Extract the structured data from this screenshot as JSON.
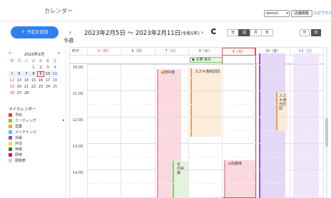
{
  "header": {
    "app_title": "カレンダー",
    "user_select": "demo1",
    "store_button": "店舗移動",
    "logout": "ログアウト"
  },
  "toolbar": {
    "add_button": "＋ 予定を追加",
    "prev": "‹",
    "next": "›",
    "range_title": "2023年2月5日 ～ 2023年2月11日",
    "range_week": "(令和5年)",
    "today_label": "今週",
    "views": [
      "日",
      "週",
      "月",
      "年"
    ],
    "active_view": "週",
    "print": "印",
    "export": "出"
  },
  "mini_calendar": {
    "title": "2023年2月",
    "prev": "«",
    "next": "»",
    "weekdays": [
      "日",
      "月",
      "火",
      "水",
      "木",
      "金",
      "土"
    ],
    "weeks": [
      [
        "",
        "",
        "",
        "1",
        "2",
        "3",
        "4"
      ],
      [
        "5",
        "6",
        "7",
        "8",
        "9",
        "10",
        "11"
      ],
      [
        "12",
        "13",
        "14",
        "15",
        "16",
        "17",
        "18"
      ],
      [
        "19",
        "20",
        "21",
        "22",
        "23",
        "24",
        "25"
      ],
      [
        "26",
        "27",
        "28",
        "",
        "",
        "",
        ""
      ]
    ],
    "selected": "9"
  },
  "my_calendars": {
    "title": "マイカレンダー",
    "items": [
      {
        "label": "予約",
        "color": "#e04040"
      },
      {
        "label": "ミーティング",
        "color": "#8bc34a"
      },
      {
        "label": "営業",
        "color": "#f5a623"
      },
      {
        "label": "メンテナンス",
        "color": "#4fc3f7"
      },
      {
        "label": "出張",
        "color": "#7e57c2"
      },
      {
        "label": "外出",
        "color": "#fdd835"
      },
      {
        "label": "休暇",
        "color": "#2e7d32"
      },
      {
        "label": "研修",
        "color": "#c2185b"
      },
      {
        "label": "勤務表",
        "color": "#f8bbd0"
      }
    ]
  },
  "week": {
    "time_header": "終日",
    "days": [
      {
        "label": "5（日）",
        "type": "sun"
      },
      {
        "label": "6（月）",
        "type": ""
      },
      {
        "label": "7（火）",
        "type": ""
      },
      {
        "label": "8（水）",
        "type": ""
      },
      {
        "label": "9（木）",
        "type": "today"
      },
      {
        "label": "10（金）",
        "type": ""
      },
      {
        "label": "11（土）",
        "type": "sat"
      }
    ],
    "times": [
      "10:00",
      "11:00",
      "12:00",
      "13:00",
      "14:00"
    ],
    "allday_event": "大西 休み"
  },
  "events": {
    "tanaka": "田中様",
    "suzuki_visit": "スズキ通商訪問",
    "suzuki_short": "スズ\nキ通\n商訪\n問",
    "inside_meeting": "社\n内会\n議",
    "sato": "佐藤様",
    "tag": "◆"
  },
  "colors": {
    "accent": "#2f80ed",
    "today_border": "#e05050"
  }
}
